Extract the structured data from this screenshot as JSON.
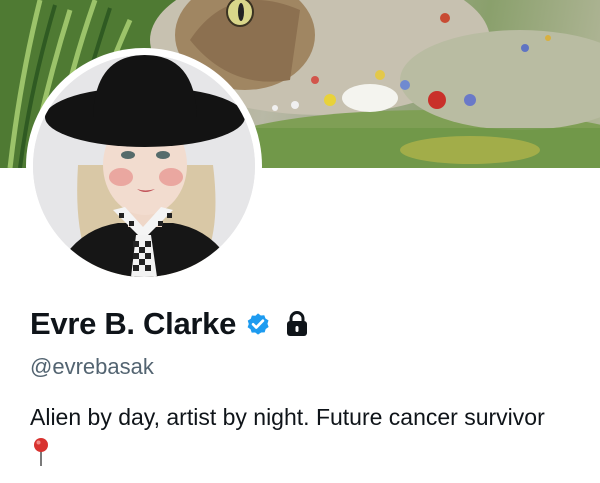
{
  "profile": {
    "display_name": "Evre B. Clarke",
    "handle": "@evrebasak",
    "bio": "Alien by day, artist by night. Future cancer survivor",
    "verified": true,
    "protected": true
  },
  "icons": {
    "verified": "verified-badge-icon",
    "protected": "lock-icon",
    "bio_emoji": "round-pushpin-icon"
  },
  "colors": {
    "name_text": "#0f1419",
    "handle_text": "#536471",
    "verified_badge": "#1d9bf0"
  }
}
